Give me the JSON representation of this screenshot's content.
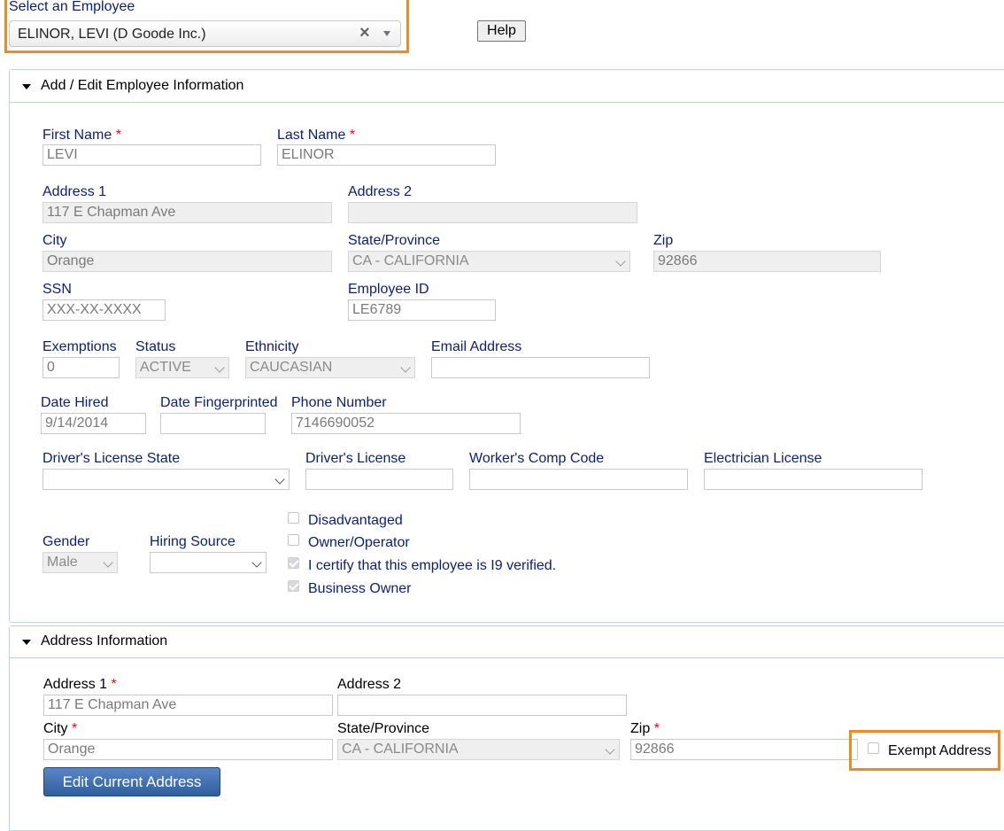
{
  "employee_select": {
    "label": "Select an Employee",
    "value": "ELINOR, LEVI (D Goode Inc.)",
    "clear_symbol": "×"
  },
  "help_button": "Help",
  "employee_section": {
    "title": "Add / Edit Employee Information",
    "first_name": {
      "label": "First Name",
      "value": "LEVI"
    },
    "last_name": {
      "label": "Last Name",
      "value": "ELINOR"
    },
    "address1": {
      "label": "Address 1",
      "value": "117 E Chapman Ave"
    },
    "address2": {
      "label": "Address 2",
      "value": ""
    },
    "city": {
      "label": "City",
      "value": "Orange"
    },
    "state": {
      "label": "State/Province",
      "value": "CA - CALIFORNIA"
    },
    "zip": {
      "label": "Zip",
      "value": "92866"
    },
    "ssn": {
      "label": "SSN",
      "value": "XXX-XX-XXXX"
    },
    "employee_id": {
      "label": "Employee ID",
      "value": "LE6789"
    },
    "exemptions": {
      "label": "Exemptions",
      "value": "0"
    },
    "status": {
      "label": "Status",
      "value": "ACTIVE"
    },
    "ethnicity": {
      "label": "Ethnicity",
      "value": "CAUCASIAN"
    },
    "email": {
      "label": "Email Address",
      "value": ""
    },
    "date_hired": {
      "label": "Date Hired",
      "value": "9/14/2014"
    },
    "date_fingerprinted": {
      "label": "Date Fingerprinted",
      "value": ""
    },
    "phone": {
      "label": "Phone Number",
      "value": "7146690052"
    },
    "dl_state": {
      "label": "Driver's License State",
      "value": ""
    },
    "dl": {
      "label": "Driver's License",
      "value": ""
    },
    "workers_comp": {
      "label": "Worker's Comp Code",
      "value": ""
    },
    "electrician": {
      "label": "Electrician License",
      "value": ""
    },
    "gender": {
      "label": "Gender",
      "value": "Male"
    },
    "hiring_source": {
      "label": "Hiring Source",
      "value": ""
    },
    "checkboxes": [
      {
        "label": "Disadvantaged",
        "checked": false
      },
      {
        "label": "Owner/Operator",
        "checked": false
      },
      {
        "label": "I certify that this employee is I9 verified.",
        "checked": true
      },
      {
        "label": "Business Owner",
        "checked": true
      }
    ]
  },
  "address_section": {
    "title": "Address Information",
    "address1": {
      "label": "Address 1",
      "value": "117 E Chapman Ave"
    },
    "address2": {
      "label": "Address 2",
      "value": ""
    },
    "city": {
      "label": "City",
      "value": "Orange"
    },
    "state": {
      "label": "State/Province",
      "value": "CA - CALIFORNIA"
    },
    "zip": {
      "label": "Zip",
      "value": "92866"
    },
    "exempt_address": {
      "label": "Exempt Address",
      "checked": false
    },
    "edit_button": "Edit Current Address"
  },
  "colors": {
    "highlight": "#f28a22",
    "label_blue": "#0a1f7a",
    "required": "#dd1111",
    "button_blue": "#2f5f9e"
  },
  "icons": [
    "clear-icon",
    "dropdown-arrow-icon",
    "collapse-triangle-icon",
    "chevron-down-icon"
  ]
}
